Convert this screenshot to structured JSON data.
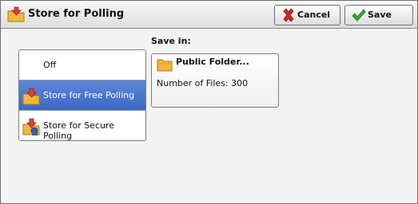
{
  "window": {
    "title": "Store for Polling",
    "title_icon": "folder-arrow-icon"
  },
  "toolbar": {
    "cancel_label": "Cancel",
    "cancel_icon": "red-x-icon",
    "save_label": "Save",
    "save_icon": "green-check-icon"
  },
  "options": [
    {
      "label": "Off",
      "icon": "",
      "selected": false
    },
    {
      "label": "Store for Free Polling",
      "icon": "folder-arrow-icon",
      "selected": true
    },
    {
      "label": "Store for Secure Polling",
      "icon": "folder-lock-icon",
      "selected": false
    }
  ],
  "save_in": {
    "label": "Save in:",
    "folder_name": "Public Folder...",
    "files_text": "Number of Files: 300",
    "folder_icon": "folder-icon"
  },
  "colors": {
    "selected": "#3d69c4",
    "folder": "#f2b73a",
    "arrow": "#e23b3b",
    "cancel_x": "#d32525",
    "save_check": "#37a83a"
  }
}
